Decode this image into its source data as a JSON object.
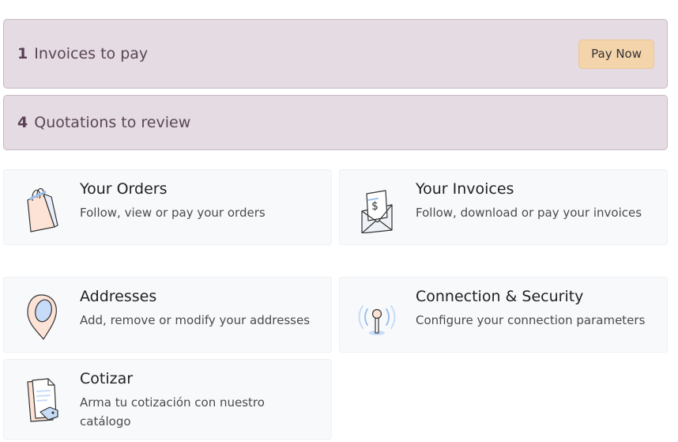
{
  "alerts": {
    "invoices": {
      "count": "1",
      "label": "Invoices to pay",
      "button": "Pay Now"
    },
    "quotations": {
      "count": "4",
      "label": "Quotations to review"
    }
  },
  "cards": {
    "orders": {
      "title": "Your Orders",
      "description": "Follow, view or pay your orders",
      "icon": "shopping-bag-icon"
    },
    "invoices": {
      "title": "Your Invoices",
      "description": "Follow, download or pay your invoices",
      "icon": "invoice-envelope-icon"
    },
    "addresses": {
      "title": "Addresses",
      "description": "Add, remove or modify your addresses",
      "icon": "map-pin-icon"
    },
    "security": {
      "title": "Connection & Security",
      "description": "Configure your connection parameters",
      "icon": "antenna-icon"
    },
    "cotizar": {
      "title": "Cotizar",
      "description": "Arma tu cotización con nuestro catálogo",
      "icon": "document-tag-icon"
    }
  },
  "colors": {
    "alert_bg": "#e5dbe3",
    "button_bg": "#f4d4ab",
    "card_bg": "#f8f9fb"
  }
}
